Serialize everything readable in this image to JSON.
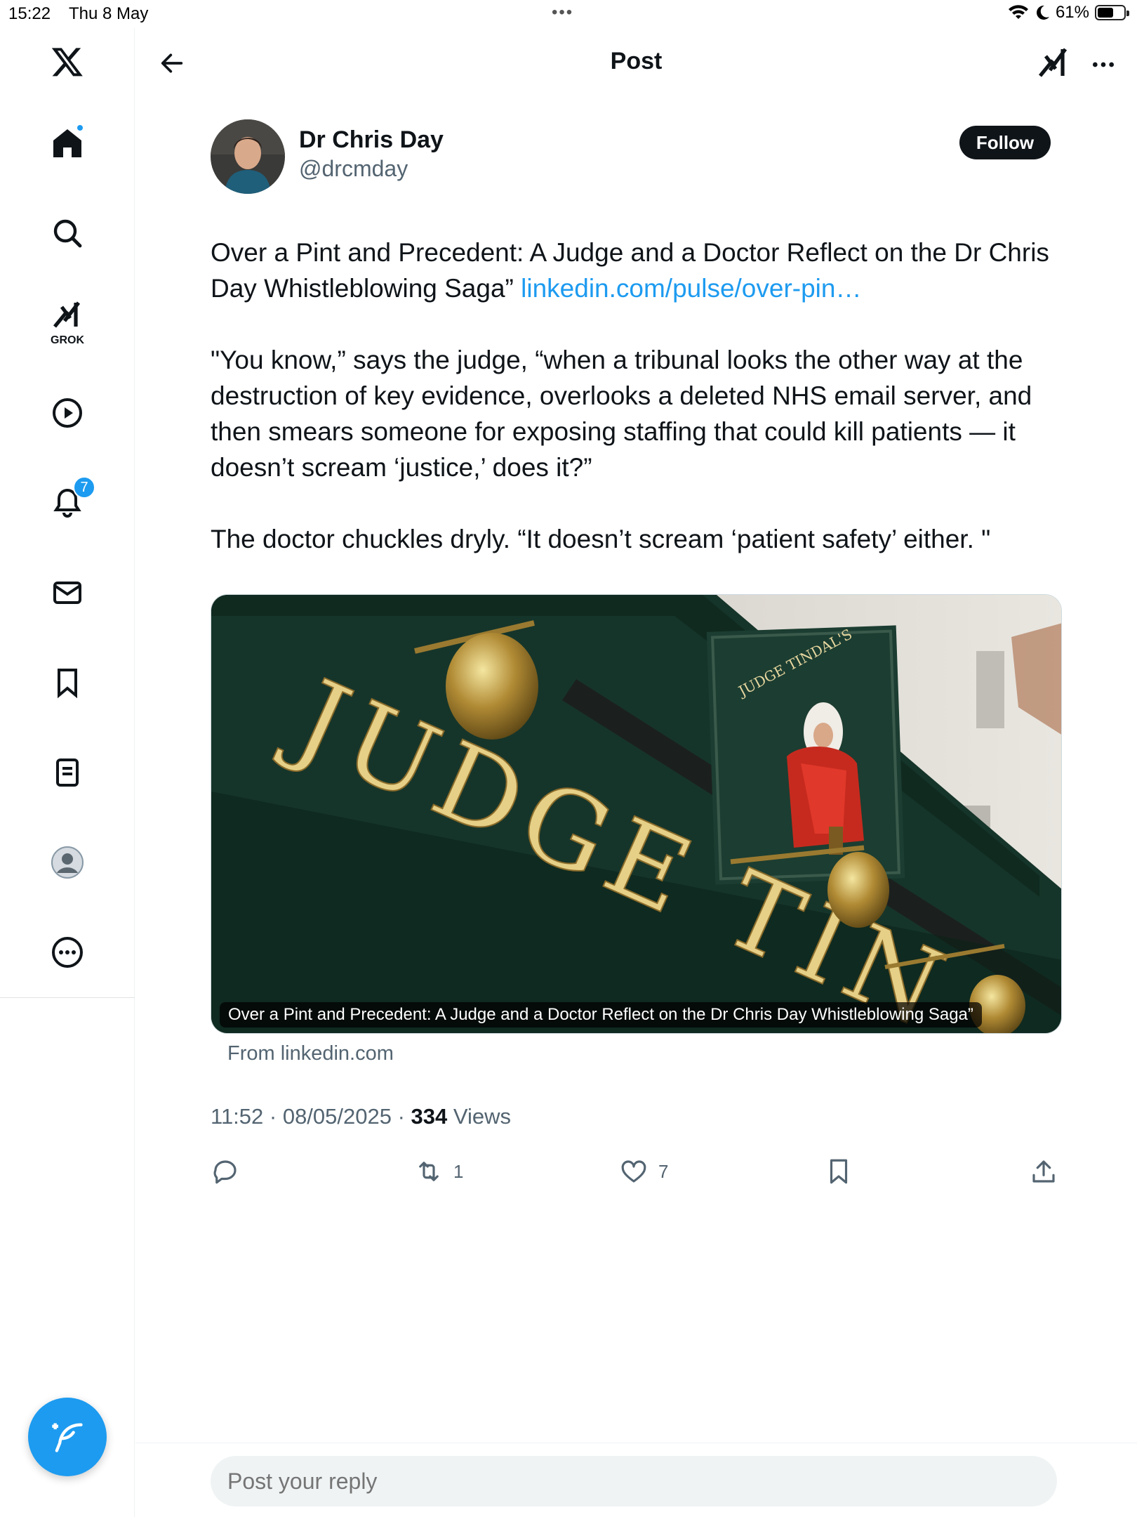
{
  "status_bar": {
    "time": "15:22",
    "date": "Thu 8 May",
    "battery": "61%",
    "battery_level": 0.61
  },
  "header": {
    "title": "Post"
  },
  "sidebar": {
    "grok_label": "GROK",
    "notifications_count": "7",
    "items": [
      "x-logo",
      "home",
      "search",
      "grok",
      "video",
      "notifications",
      "messages",
      "bookmarks",
      "lists",
      "profile",
      "more"
    ]
  },
  "post": {
    "author_name": "Dr Chris Day",
    "author_handle": "@drcmday",
    "follow_label": "Follow",
    "text_line1": "Over a Pint and Precedent: A Judge and a Doctor Reflect on the Dr Chris Day Whistleblowing Saga” ",
    "link_text": "linkedin.com/pulse/over-pin…",
    "paragraph2": "\"You know,” says the judge, “when a tribunal looks the other way at the destruction of key evidence, overlooks a deleted NHS email server, and then smears someone for exposing staffing that could kill patients — it doesn’t scream ‘justice,’ does it?”",
    "paragraph3": "The doctor chuckles dryly. “It doesn’t scream ‘patient safety’ either. \"",
    "card": {
      "sign_text": "JUDGE TIN",
      "hanging_sign_text": "JUDGE TINDAL'S",
      "caption": "Over a Pint and Precedent: A Judge and a Doctor Reflect on the Dr Chris Day Whistleblowing Saga”",
      "source": "From linkedin.com"
    },
    "meta_time": "11:52 · 08/05/2025 · ",
    "views_count": "334",
    "views_label": " Views",
    "retweets": "1",
    "likes": "7"
  },
  "reply": {
    "placeholder": "Post your reply"
  }
}
